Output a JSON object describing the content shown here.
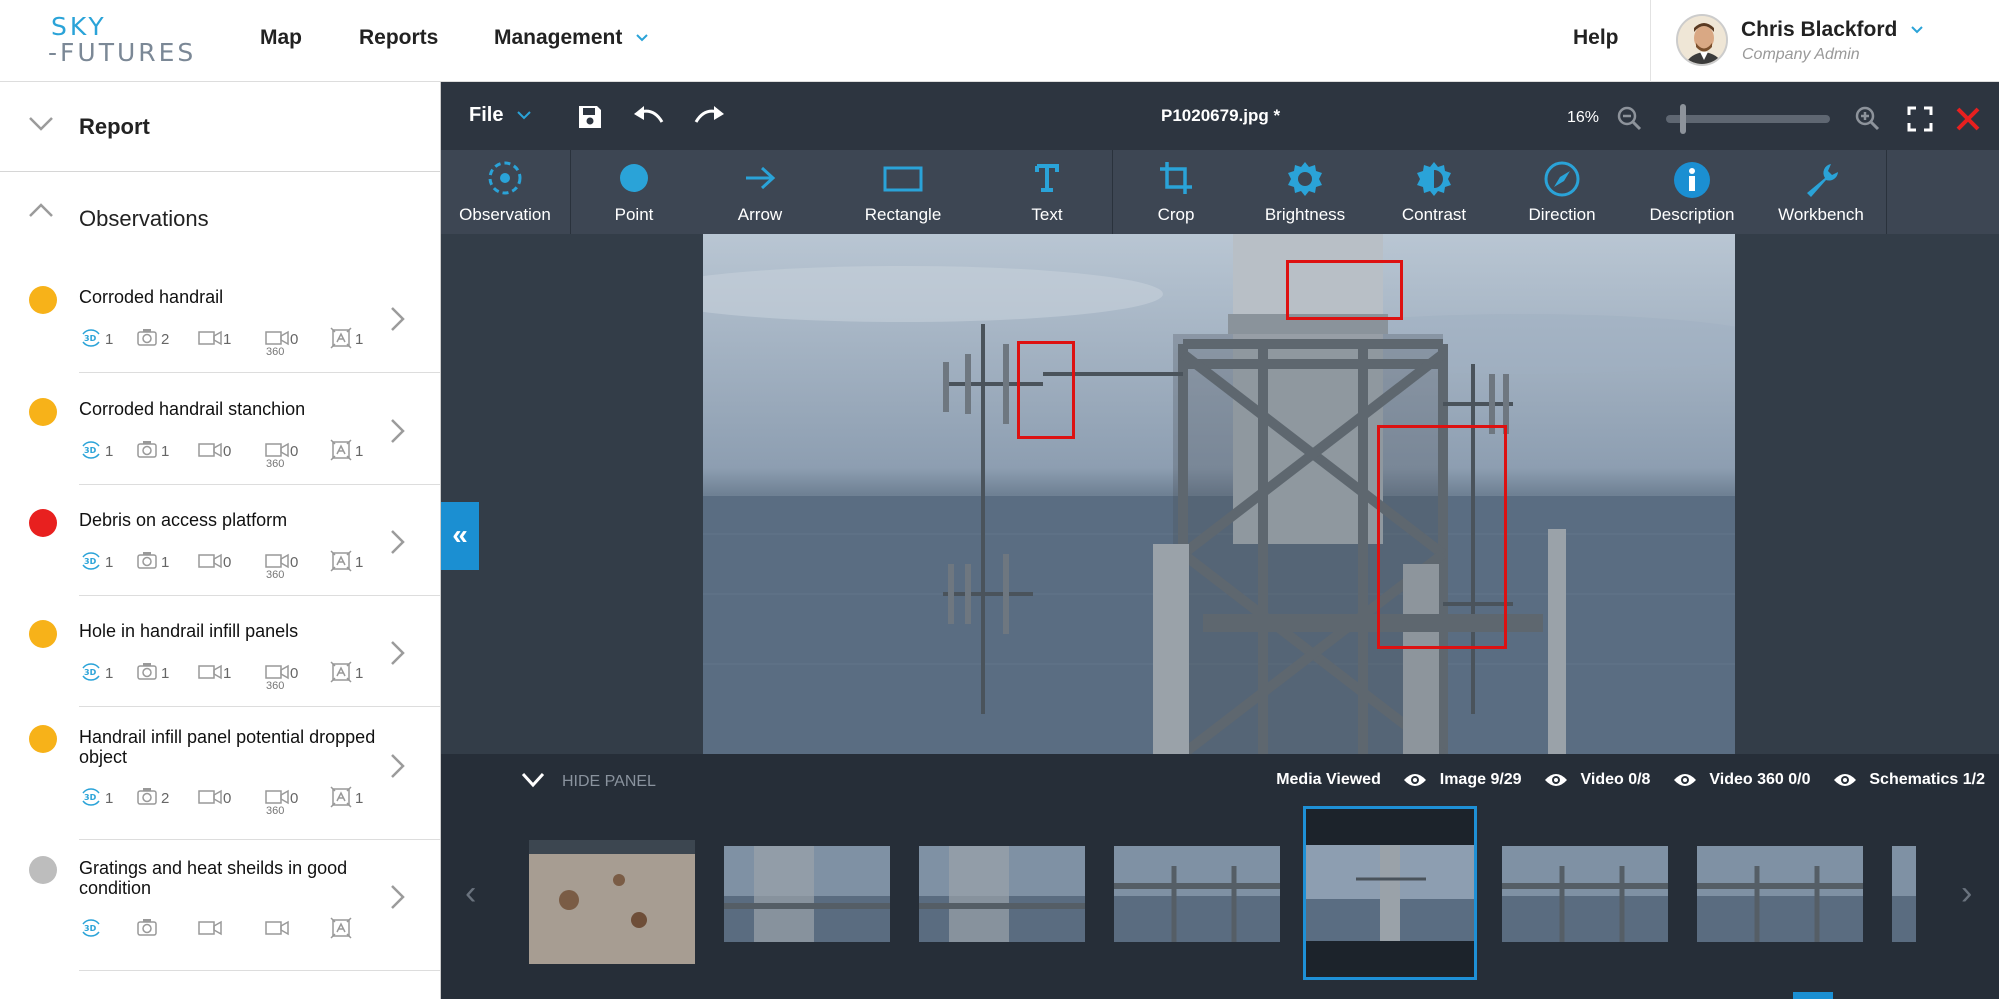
{
  "nav": {
    "logo_top": "SKY",
    "logo_bottom": "-FUTURES",
    "items": [
      "Map",
      "Reports",
      "Management"
    ],
    "help": "Help",
    "user_name": "Chris Blackford",
    "user_role": "Company Admin"
  },
  "sidebar": {
    "report_label": "Report",
    "observations_label": "Observations",
    "observations": [
      {
        "title": "Corroded handrail",
        "status_color": "#f7b219",
        "counts": [
          "1",
          "2",
          "1",
          "0",
          "1"
        ]
      },
      {
        "title": "Corroded handrail stanchion",
        "status_color": "#f7b219",
        "counts": [
          "1",
          "1",
          "0",
          "0",
          "1"
        ]
      },
      {
        "title": "Debris on access platform",
        "status_color": "#e8201f",
        "counts": [
          "1",
          "1",
          "0",
          "0",
          "1"
        ]
      },
      {
        "title": "Hole in handrail infill panels",
        "status_color": "#f7b219",
        "counts": [
          "1",
          "1",
          "1",
          "0",
          "1"
        ]
      },
      {
        "title": "Handrail infill panel potential dropped object",
        "status_color": "#f7b219",
        "counts": [
          "1",
          "2",
          "0",
          "0",
          "1"
        ]
      },
      {
        "title": "Gratings and heat sheilds in good condition",
        "status_color": "#bdbdbd",
        "counts": [
          "",
          "",
          "",
          "",
          ""
        ]
      }
    ],
    "count_icons": [
      "3d-view-icon",
      "camera-icon",
      "video-icon",
      "video-360-icon",
      "schematic-icon"
    ],
    "video360_sub": "360"
  },
  "editor": {
    "file_menu": "File",
    "filename": "P1020679.jpg *",
    "zoom": "16%",
    "zoom_level": 0.05,
    "tools": [
      "Observation",
      "Point",
      "Arrow",
      "Rectangle",
      "Text",
      "Crop",
      "Brightness",
      "Contrast",
      "Direction",
      "Description",
      "Workbench"
    ],
    "collapse_glyph": "«",
    "accent": "#1b8fd2"
  },
  "panel": {
    "hide_label": "HIDE PANEL",
    "media_viewed": "Media Viewed",
    "image_count": "Image 9/29",
    "video_count": "Video 0/8",
    "video360_count": "Video 360 0/0",
    "schematics_count": "Schematics 1/2",
    "prev_glyph": "‹",
    "next_glyph": "›"
  }
}
